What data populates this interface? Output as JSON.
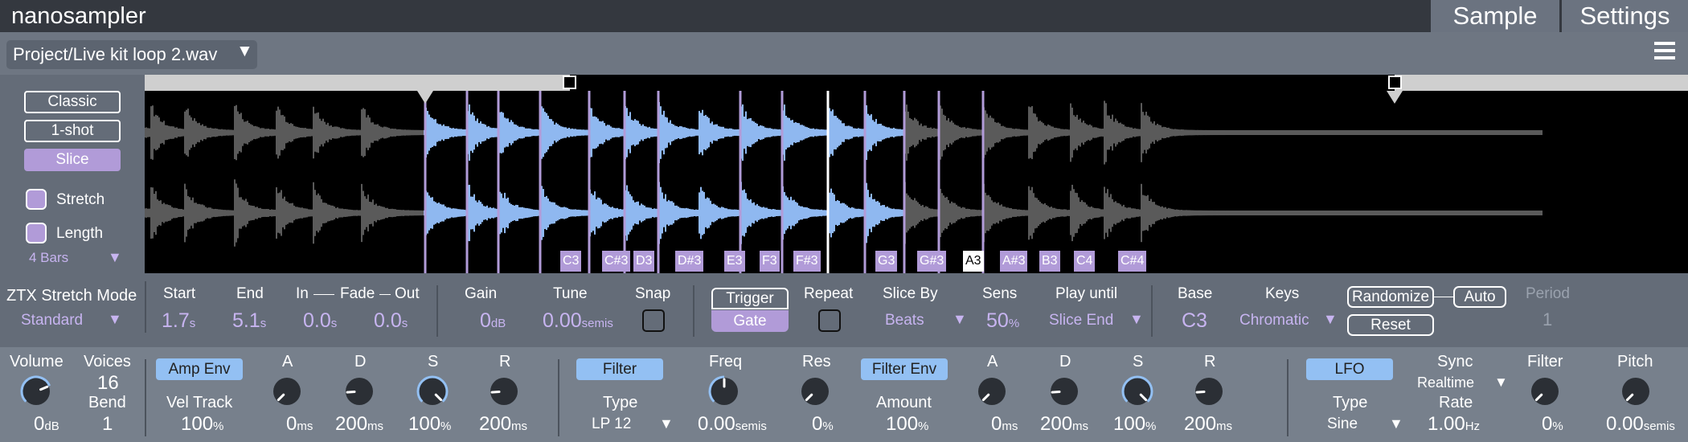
{
  "app": {
    "title": "nanosampler"
  },
  "tabs": [
    {
      "label": "Sample"
    },
    {
      "label": "Settings"
    }
  ],
  "file": {
    "name": "Project/Live kit loop 2.wav"
  },
  "modes": {
    "classic": "Classic",
    "oneshot": "1-shot",
    "slice": "Slice",
    "selected": "Slice"
  },
  "options": {
    "stretch": "Stretch",
    "length": "Length",
    "stretch_checked": true,
    "length_checked": true,
    "length_value": "4 Bars"
  },
  "slices": [
    "C3",
    "C#3",
    "D3",
    "D#3",
    "E3",
    "F3",
    "F#3",
    "G3",
    "G#3",
    "A3",
    "A#3",
    "B3",
    "C4",
    "C#4"
  ],
  "selected_slice": "A3",
  "ztx": {
    "title": "ZTX Stretch Mode",
    "value": "Standard"
  },
  "controls": {
    "start": {
      "label": "Start",
      "value": "1.7",
      "unit": "s"
    },
    "end": {
      "label": "End",
      "value": "5.1",
      "unit": "s"
    },
    "in_label": "In",
    "fade_label": "Fade",
    "out_label": "Out",
    "in": {
      "value": "0.0",
      "unit": "s"
    },
    "out": {
      "value": "0.0",
      "unit": "s"
    },
    "gain": {
      "label": "Gain",
      "value": "0",
      "unit": "dB"
    },
    "tune": {
      "label": "Tune",
      "value": "0.00",
      "unit": "semis"
    },
    "snap": {
      "label": "Snap"
    },
    "trigger": "Trigger",
    "gate": "Gate",
    "repeat": {
      "label": "Repeat"
    },
    "slice_by": {
      "label": "Slice By",
      "value": "Beats"
    },
    "sens": {
      "label": "Sens",
      "value": "50",
      "unit": "%"
    },
    "play_until": {
      "label": "Play until",
      "value": "Slice End"
    },
    "base": {
      "label": "Base",
      "value": "C3"
    },
    "keys": {
      "label": "Keys",
      "value": "Chromatic"
    },
    "randomize": "Randomize",
    "auto": "Auto",
    "reset": "Reset",
    "period": {
      "label": "Period",
      "value": "1"
    }
  },
  "bottom": {
    "volume": {
      "label": "Volume",
      "value": "0",
      "unit": "dB"
    },
    "voices": {
      "label": "Voices",
      "value": "16"
    },
    "bend": {
      "label": "Bend",
      "value": "1"
    },
    "amp_env": {
      "title": "Amp Env",
      "vel_track_label": "Vel Track",
      "vel_track_value": "100",
      "vel_track_unit": "%",
      "a": {
        "label": "A",
        "value": "0",
        "unit": "ms"
      },
      "d": {
        "label": "D",
        "value": "200",
        "unit": "ms"
      },
      "s": {
        "label": "S",
        "value": "100",
        "unit": "%"
      },
      "r": {
        "label": "R",
        "value": "200",
        "unit": "ms"
      }
    },
    "filter": {
      "title": "Filter",
      "type_label": "Type",
      "type_value": "LP 12",
      "freq": {
        "label": "Freq",
        "value": "0.00",
        "unit": "semis"
      },
      "res": {
        "label": "Res",
        "value": "0",
        "unit": "%"
      }
    },
    "filter_env": {
      "title": "Filter Env",
      "amount_label": "Amount",
      "amount_value": "100",
      "amount_unit": "%",
      "a": {
        "label": "A",
        "value": "0",
        "unit": "ms"
      },
      "d": {
        "label": "D",
        "value": "200",
        "unit": "ms"
      },
      "s": {
        "label": "S",
        "value": "100",
        "unit": "%"
      },
      "r": {
        "label": "R",
        "value": "200",
        "unit": "ms"
      }
    },
    "lfo": {
      "title": "LFO",
      "type_label": "Type",
      "type_value": "Sine",
      "sync_label": "Sync",
      "sync_value": "Realtime",
      "rate_label": "Rate",
      "rate_value": "1.00",
      "rate_unit": "Hz",
      "filter": {
        "label": "Filter",
        "value": "0",
        "unit": "%"
      },
      "pitch": {
        "label": "Pitch",
        "value": "0.00",
        "unit": "semis"
      }
    }
  },
  "colors": {
    "accent": "#b19bd8",
    "accent_text": "#c7b4f0",
    "blue": "#93c0f3",
    "wave_active": "#8fb8f0",
    "wave_inactive": "#5a5a5a"
  }
}
